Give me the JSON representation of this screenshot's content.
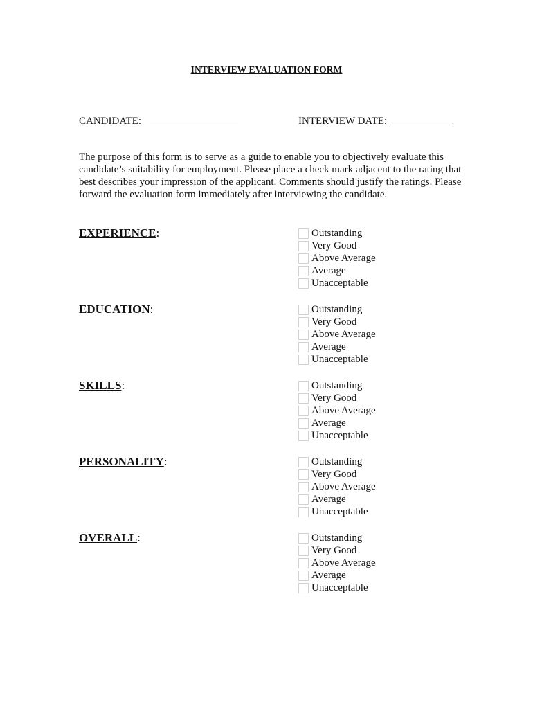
{
  "document": {
    "title": "INTERVIEW EVALUATION FORM",
    "fields": {
      "candidate_label": "CANDIDATE:",
      "candidate_value": "",
      "interview_date_label": "INTERVIEW DATE:",
      "interview_date_value": ""
    },
    "intro": "The purpose of this form is to serve as a guide to enable you to objectively evaluate this candidate’s suitability for employment. Please place a check mark adjacent to the rating that best describes your impression of the applicant. Comments should justify the ratings. Please forward the evaluation form immediately after interviewing the candidate.",
    "colon": ":",
    "sections": [
      {
        "name": "EXPERIENCE",
        "options": [
          "Outstanding",
          "Very Good",
          "Above Average",
          "Average",
          "Unacceptable"
        ]
      },
      {
        "name": "EDUCATION",
        "options": [
          "Outstanding",
          "Very Good",
          "Above Average",
          "Average",
          "Unacceptable"
        ]
      },
      {
        "name": "SKILLS",
        "options": [
          "Outstanding",
          "Very Good",
          "Above Average",
          "Average",
          "Unacceptable"
        ]
      },
      {
        "name": "PERSONALITY",
        "options": [
          "Outstanding",
          "Very Good",
          "Above Average",
          "Average",
          "Unacceptable"
        ]
      },
      {
        "name": "OVERALL",
        "options": [
          "Outstanding",
          "Very Good",
          "Above Average",
          "Average",
          "Unacceptable"
        ]
      }
    ]
  }
}
